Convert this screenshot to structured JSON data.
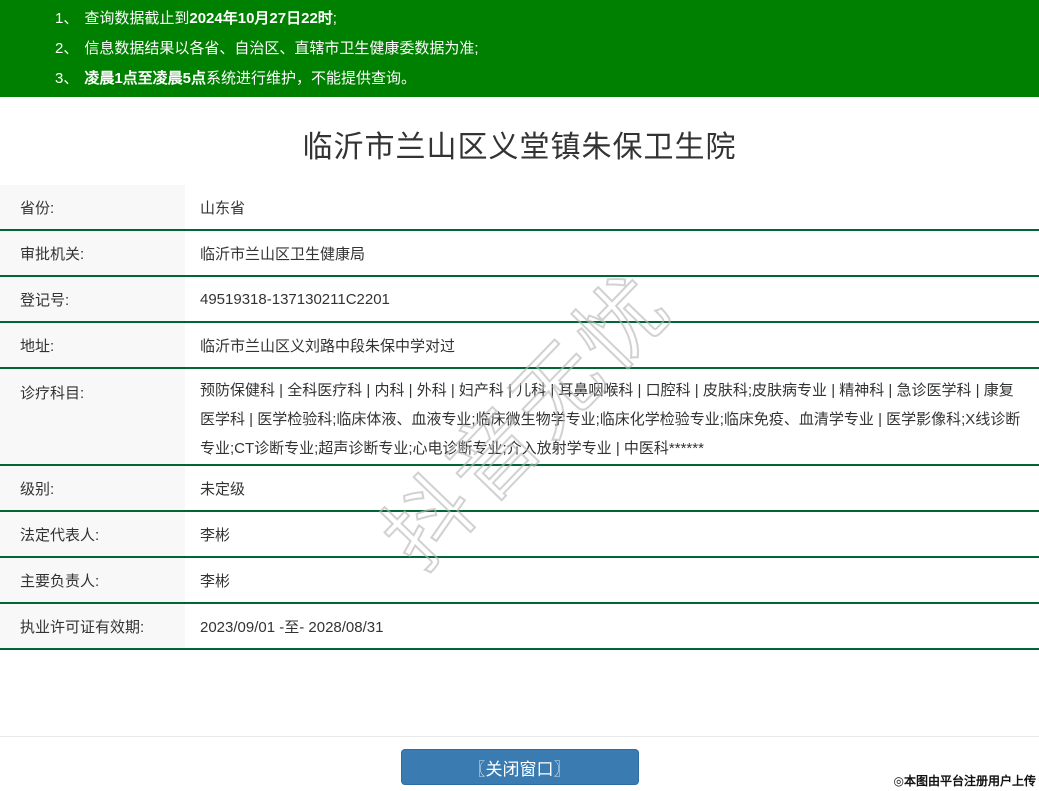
{
  "notice_bar": {
    "items": [
      {
        "num": "1、",
        "pre": "查询数据截止到",
        "bold": "2024年10月27日22时",
        "post": ";"
      },
      {
        "num": "2、",
        "pre": "信息数据结果以各省、自治区、直辖市卫生健康委数据为准;",
        "bold": "",
        "post": ""
      },
      {
        "num": "3、",
        "pre": "",
        "bold": "凌晨1点至凌晨5点",
        "post": "系统进行维护，不能提供查询。"
      }
    ]
  },
  "page_title": "临沂市兰山区义堂镇朱保卫生院",
  "table": {
    "rows": [
      {
        "label": "省份:",
        "value": "山东省"
      },
      {
        "label": "审批机关:",
        "value": "临沂市兰山区卫生健康局"
      },
      {
        "label": "登记号:",
        "value": "49519318-137130211C2201"
      },
      {
        "label": "地址:",
        "value": "临沂市兰山区义刘路中段朱保中学对过"
      },
      {
        "label": "诊疗科目:",
        "value": "预防保健科 | 全科医疗科 | 内科 | 外科 | 妇产科 | 儿科 | 耳鼻咽喉科 | 口腔科 | 皮肤科;皮肤病专业 | 精神科 | 急诊医学科 | 康复医学科 | 医学检验科;临床体液、血液专业;临床微生物学专业;临床化学检验专业;临床免疫、血清学专业 | 医学影像科;X线诊断专业;CT诊断专业;超声诊断专业;心电诊断专业;介入放射学专业 | 中医科******"
      },
      {
        "label": "级别:",
        "value": "未定级"
      },
      {
        "label": "法定代表人:",
        "value": "李彬"
      },
      {
        "label": "主要负责人:",
        "value": "李彬"
      },
      {
        "label": "执业许可证有效期:",
        "value": "2023/09/01 -至- 2028/08/31"
      }
    ]
  },
  "watermark": "抖音无忧",
  "footer": {
    "close_button": "〖关闭窗口〗",
    "copyright": "◎本图由平台注册用户上传"
  },
  "colors": {
    "header_green": "#008000",
    "row_border_green": "#006633",
    "label_bg": "#f8f8f8",
    "button_blue": "#3a7cb2",
    "text": "#333333"
  }
}
